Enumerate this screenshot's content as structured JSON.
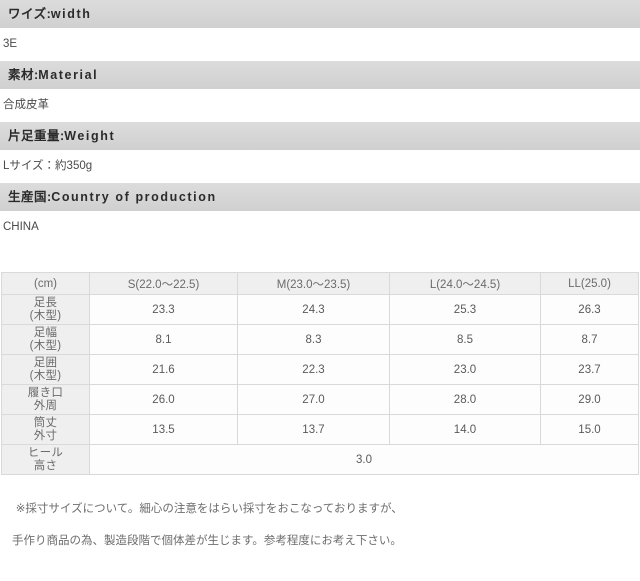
{
  "spec_sections": [
    {
      "heading_jp": "ワイズ",
      "heading_sep": ":",
      "heading_en": "width",
      "value": "3E"
    },
    {
      "heading_jp": "素材",
      "heading_sep": ":",
      "heading_en": "Material",
      "value": "合成皮革"
    },
    {
      "heading_jp": "片足重量",
      "heading_sep": ":",
      "heading_en": "Weight",
      "value": "Lサイズ：約350g"
    },
    {
      "heading_jp": "生産国",
      "heading_sep": ":",
      "heading_en": "Country of production",
      "value": "CHINA"
    }
  ],
  "size_table": {
    "columns": [
      "(cm)",
      "S(22.0〜22.5)",
      "M(23.0〜23.5)",
      "L(24.0〜24.5)",
      "LL(25.0)"
    ],
    "rows": [
      {
        "label_line1": "足長",
        "label_line2": "(木型)",
        "values": [
          "23.3",
          "24.3",
          "25.3",
          "26.3"
        ],
        "merged": false
      },
      {
        "label_line1": "足幅",
        "label_line2": "(木型)",
        "values": [
          "8.1",
          "8.3",
          "8.5",
          "8.7"
        ],
        "merged": false
      },
      {
        "label_line1": "足囲",
        "label_line2": "(木型)",
        "values": [
          "21.6",
          "22.3",
          "23.0",
          "23.7"
        ],
        "merged": false
      },
      {
        "label_line1": "履き口",
        "label_line2": "外周",
        "values": [
          "26.0",
          "27.0",
          "28.0",
          "29.0"
        ],
        "merged": false
      },
      {
        "label_line1": "筒丈",
        "label_line2": "外寸",
        "values": [
          "13.5",
          "13.7",
          "14.0",
          "15.0"
        ],
        "merged": false
      },
      {
        "label_line1": "ヒール",
        "label_line2": "高さ",
        "values": [
          "3.0"
        ],
        "merged": true
      }
    ]
  },
  "note": {
    "line1": "※採寸サイズについて。細心の注意をはらい採寸をおこなっておりますが、",
    "line2": "手作り商品の為、製造段階で個体差が生じます。参考程度にお考え下さい。"
  },
  "colors": {
    "section_header_bg": "#d6d6d6",
    "section_header_text": "#2b2b2b",
    "table_header_bg": "#efefef",
    "table_border": "#d9d9d9",
    "body_text": "#4a4a4a",
    "note_text": "#6d6d6d"
  }
}
